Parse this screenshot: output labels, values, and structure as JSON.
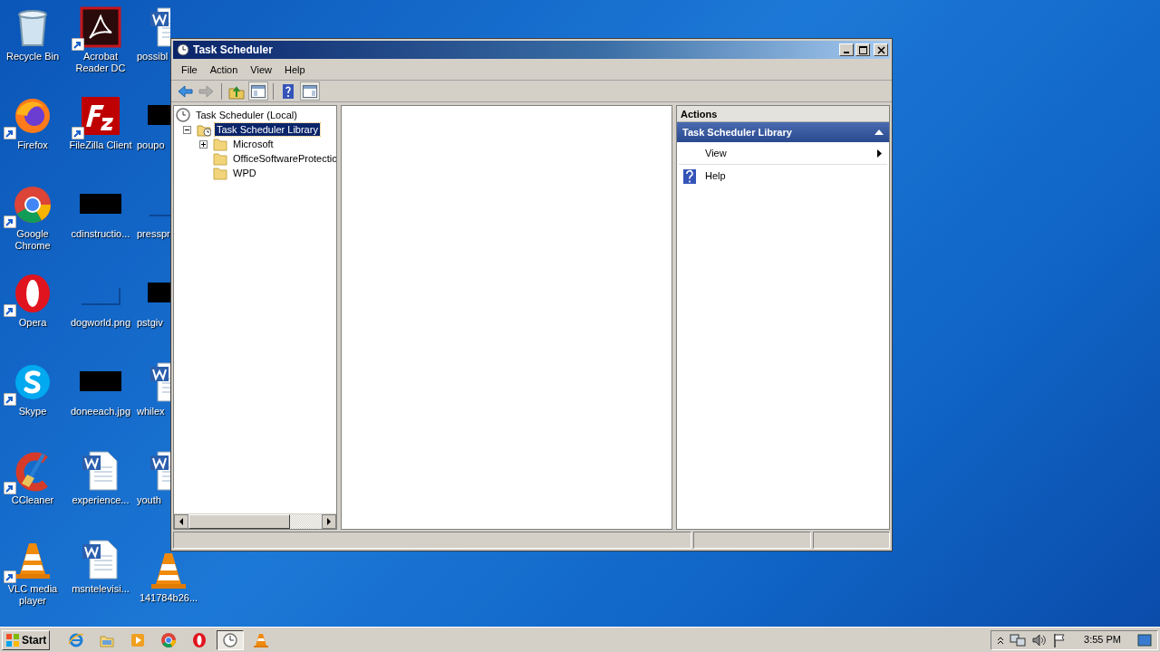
{
  "desktop": {
    "columns": [
      [
        {
          "label": "Recycle Bin",
          "kind": "recycle",
          "shortcut": false
        },
        {
          "label": "Firefox",
          "kind": "firefox",
          "shortcut": true
        },
        {
          "label": "Google Chrome",
          "kind": "chrome",
          "shortcut": true
        },
        {
          "label": "Opera",
          "kind": "opera",
          "shortcut": true
        },
        {
          "label": "Skype",
          "kind": "skype",
          "shortcut": true
        },
        {
          "label": "CCleaner",
          "kind": "ccleaner",
          "shortcut": true
        },
        {
          "label": "VLC media player",
          "kind": "vlc",
          "shortcut": true
        }
      ],
      [
        {
          "label": "Acrobat Reader DC",
          "kind": "acrobat",
          "shortcut": true
        },
        {
          "label": "FileZilla Client",
          "kind": "filezilla",
          "shortcut": true
        },
        {
          "label": "cdinstructio...",
          "kind": "thumbnail",
          "shortcut": false
        },
        {
          "label": "dogworld.png",
          "kind": "blank",
          "shortcut": false
        },
        {
          "label": "doneeach.jpg",
          "kind": "thumbnail",
          "shortcut": false
        },
        {
          "label": "experience...",
          "kind": "word",
          "shortcut": false
        },
        {
          "label": "msntelevisi...",
          "kind": "word",
          "shortcut": false
        }
      ],
      [
        {
          "label": "possibl",
          "kind": "word",
          "shortcut": false
        },
        {
          "label": "poupo",
          "kind": "thumbnail",
          "shortcut": false
        },
        {
          "label": "presspr",
          "kind": "blank",
          "shortcut": false
        },
        {
          "label": "pstgiv",
          "kind": "thumbnail",
          "shortcut": false
        },
        {
          "label": "whilex",
          "kind": "word",
          "shortcut": false
        },
        {
          "label": "youth",
          "kind": "word",
          "shortcut": false
        },
        {
          "label": "141784b26...",
          "kind": "vlc",
          "shortcut": false
        }
      ]
    ]
  },
  "window": {
    "title": "Task Scheduler",
    "menu": [
      "File",
      "Action",
      "View",
      "Help"
    ],
    "toolbar": [
      {
        "kind": "back",
        "disabled": false
      },
      {
        "kind": "forward",
        "disabled": true
      },
      {
        "kind": "separator"
      },
      {
        "kind": "up",
        "disabled": false
      },
      {
        "kind": "tree",
        "disabled": false
      },
      {
        "kind": "separator"
      },
      {
        "kind": "help",
        "disabled": false
      },
      {
        "kind": "panel",
        "disabled": false
      }
    ],
    "tree": [
      {
        "label": "Task Scheduler (Local)",
        "kind": "clock",
        "selected": false,
        "children": [
          {
            "label": "Task Scheduler Library",
            "kind": "library",
            "selected": true,
            "expanded": true,
            "children": [
              {
                "label": "Microsoft",
                "kind": "folder",
                "selected": false,
                "expanded": false
              },
              {
                "label": "OfficeSoftwareProtectio",
                "kind": "folder",
                "selected": false
              },
              {
                "label": "WPD",
                "kind": "folder",
                "selected": false
              }
            ]
          }
        ]
      }
    ],
    "actions": {
      "title": "Actions",
      "section": {
        "title": "Task Scheduler Library",
        "expanded": true
      },
      "items": [
        {
          "label": "View",
          "kind": "submenu"
        },
        {
          "label": "Help",
          "kind": "help"
        }
      ]
    }
  },
  "taskbar": {
    "start": "Start",
    "apps": [
      {
        "kind": "ie",
        "active": false
      },
      {
        "kind": "explorer",
        "active": false
      },
      {
        "kind": "media",
        "active": false
      },
      {
        "kind": "chrome",
        "active": false
      },
      {
        "kind": "opera",
        "active": false
      },
      {
        "kind": "clock",
        "active": true
      },
      {
        "kind": "vlc",
        "active": false
      }
    ],
    "clock": "3:55 PM"
  }
}
